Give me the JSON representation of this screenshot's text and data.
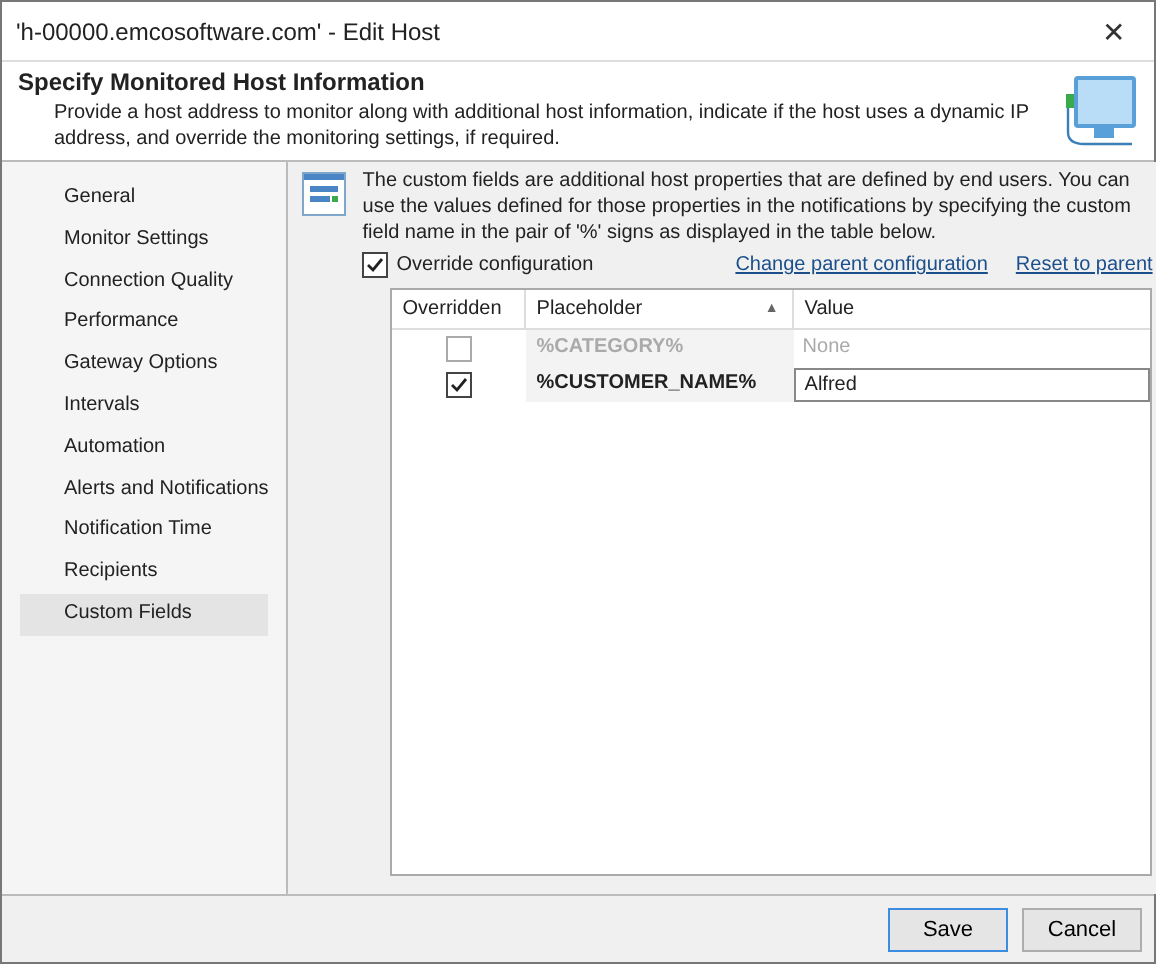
{
  "window": {
    "title": "'h-00000.emcosoftware.com' - Edit Host",
    "close": "✕"
  },
  "header": {
    "title": "Specify Monitored Host Information",
    "description": "Provide a host address to monitor along with additional host information, indicate if the host uses a dynamic IP address, and override the monitoring settings, if required."
  },
  "sidebar": {
    "items": [
      {
        "label": "General",
        "selected": false
      },
      {
        "label": "Monitor Settings",
        "selected": false
      },
      {
        "label": "Connection Quality",
        "selected": false
      },
      {
        "label": "Performance",
        "selected": false
      },
      {
        "label": "Gateway Options",
        "selected": false
      },
      {
        "label": "Intervals",
        "selected": false
      },
      {
        "label": "Automation",
        "selected": false
      },
      {
        "label": "Alerts and Notifications",
        "selected": false
      },
      {
        "label": "Notification Time",
        "selected": false
      },
      {
        "label": "Recipients",
        "selected": false
      },
      {
        "label": "Custom Fields",
        "selected": true
      }
    ]
  },
  "content": {
    "info": "The custom fields are additional host properties that are defined by end users. You can use the values defined for those properties in the notifications by specifying the custom field name in the pair of '%' signs as displayed in the table below.",
    "override": {
      "label": "Override configuration",
      "checked": true
    },
    "links": [
      "Change parent configuration",
      "Reset to parent"
    ],
    "table": {
      "columns": [
        "Overridden",
        "Placeholder",
        "Value"
      ],
      "sort_indicator": "▲",
      "rows": [
        {
          "overridden": false,
          "placeholder": "%CATEGORY%",
          "value": "None"
        },
        {
          "overridden": true,
          "placeholder": "%CUSTOMER_NAME%",
          "value": "Alfred"
        }
      ]
    }
  },
  "buttons": [
    {
      "label": "Save",
      "selected": true
    },
    {
      "label": "Cancel",
      "selected": false
    }
  ]
}
